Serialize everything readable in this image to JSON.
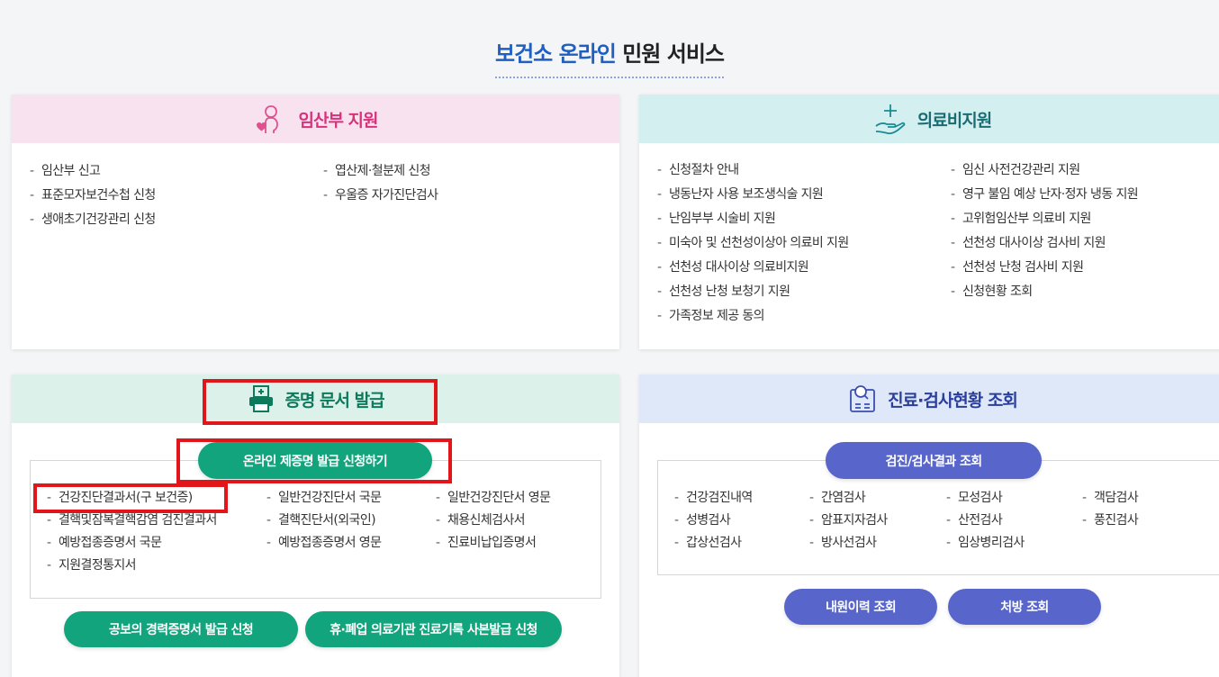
{
  "page": {
    "title_blue": "보건소 온라인",
    "title_dark": "민원 서비스"
  },
  "pregnancy": {
    "title": "임산부 지원",
    "col1": [
      "임산부 신고",
      "표준모자보건수첩 신청",
      "생애초기건강관리 신청"
    ],
    "col2": [
      "엽산제·철분제 신청",
      "우울증 자가진단검사"
    ]
  },
  "medical": {
    "title": "의료비지원",
    "col1": [
      "신청절차 안내",
      "냉동난자 사용 보조생식술 지원",
      "난임부부 시술비 지원",
      "미숙아 및 선천성이상아 의료비 지원",
      "선천성 대사이상 의료비지원",
      "선천성 난청 보청기 지원",
      "가족정보 제공 동의"
    ],
    "col2": [
      "임신 사전건강관리 지원",
      "영구 불임 예상 난자·정자 냉동 지원",
      "고위험임산부 의료비 지원",
      "선천성 대사이상 검사비 지원",
      "선천성 난청 검사비 지원",
      "신청현황 조회"
    ]
  },
  "cert": {
    "title": "증명 문서 발급",
    "main_button": "온라인 제증명 발급 신청하기",
    "col1": [
      "건강진단결과서(구 보건증)",
      "결핵및잠복결핵감염 검진결과서",
      "예방접종증명서 국문",
      "지원결정통지서"
    ],
    "col2": [
      "일반건강진단서 국문",
      "결핵진단서(외국인)",
      "예방접종증명서 영문"
    ],
    "col3": [
      "일반건강진단서 영문",
      "채용신체검사서",
      "진료비납입증명서"
    ],
    "bottom_button_1": "공보의 경력증명서 발급 신청",
    "bottom_button_2": "휴·폐업 의료기관 진료기록 사본발급 신청"
  },
  "exam": {
    "title": "진료·검사현황 조회",
    "main_button": "검진/검사결과 조회",
    "col1": [
      "건강검진내역",
      "성병검사",
      "갑상선검사"
    ],
    "col2": [
      "간염검사",
      "암표지자검사",
      "방사선검사"
    ],
    "col3": [
      "모성검사",
      "산전검사",
      "임상병리검사"
    ],
    "col4": [
      "객담검사",
      "풍진검사"
    ],
    "bottom_button_1": "내원이력 조회",
    "bottom_button_2": "처방 조회"
  },
  "colors": {
    "pregnancy_accent": "#d6337a",
    "medical_accent": "#1a6c73",
    "cert_accent": "#12a47c",
    "exam_accent": "#5866cc",
    "highlight_red": "#e0161b"
  },
  "icons": [
    "pregnant-woman-icon",
    "hand-plus-icon",
    "printer-icon",
    "clipboard-search-icon"
  ]
}
